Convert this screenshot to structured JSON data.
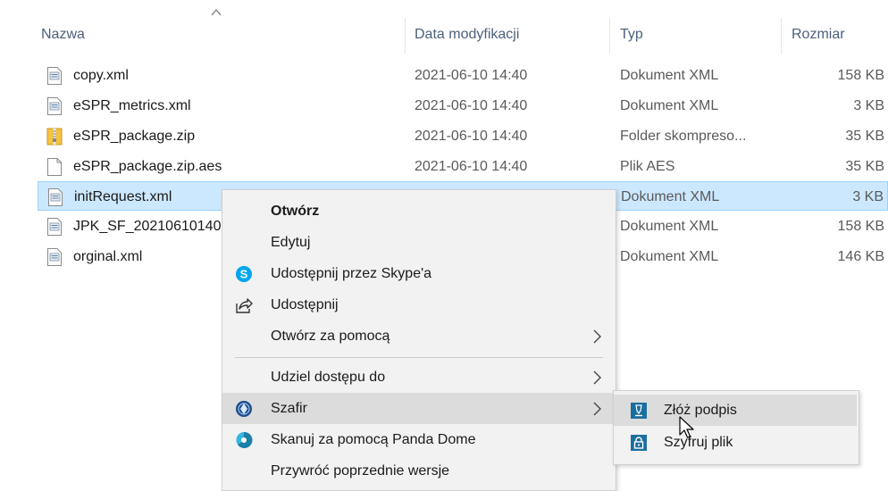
{
  "columns": {
    "name": "Nazwa",
    "modified": "Data modyfikacji",
    "type": "Typ",
    "size": "Rozmiar"
  },
  "files": [
    {
      "name": "copy.xml",
      "date": "2021-06-10 14:40",
      "type": "Dokument XML",
      "size": "158 KB",
      "icon": "xml-file-icon"
    },
    {
      "name": "eSPR_metrics.xml",
      "date": "2021-06-10 14:40",
      "type": "Dokument XML",
      "size": "3 KB",
      "icon": "xml-file-icon"
    },
    {
      "name": "eSPR_package.zip",
      "date": "2021-06-10 14:40",
      "type": "Folder skompreso...",
      "size": "35 KB",
      "icon": "zip-folder-icon"
    },
    {
      "name": "eSPR_package.zip.aes",
      "date": "2021-06-10 14:40",
      "type": "Plik AES",
      "size": "35 KB",
      "icon": "blank-file-icon"
    },
    {
      "name": "initRequest.xml",
      "date": "",
      "type": "Dokument XML",
      "size": "3 KB",
      "icon": "xml-file-icon",
      "selected": true
    },
    {
      "name": "JPK_SF_20210610140",
      "date": "",
      "type": "Dokument XML",
      "size": "158 KB",
      "icon": "xml-file-icon"
    },
    {
      "name": "orginal.xml",
      "date": "",
      "type": "Dokument XML",
      "size": "146 KB",
      "icon": "xml-file-icon"
    }
  ],
  "context_menu": {
    "open": "Otwórz",
    "edit": "Edytuj",
    "share_skype": "Udostępnij przez Skype'a",
    "share": "Udostępnij",
    "open_with": "Otwórz za pomocą",
    "give_access": "Udziel dostępu do",
    "szafir": "Szafir",
    "scan_panda": "Skanuj za pomocą Panda Dome",
    "restore_versions": "Przywróć poprzednie wersje"
  },
  "submenu": {
    "sign": "Złóż podpis",
    "encrypt": "Szyfruj plik"
  },
  "colors": {
    "selection": "#cce8ff",
    "selection_border": "#99d1ff",
    "menu_bg": "#f2f2f2",
    "menu_highlight": "#dcdcdc",
    "skype": "#00a6ed",
    "szafir_blue": "#1f4e8c",
    "teal": "#1b7fa8"
  }
}
